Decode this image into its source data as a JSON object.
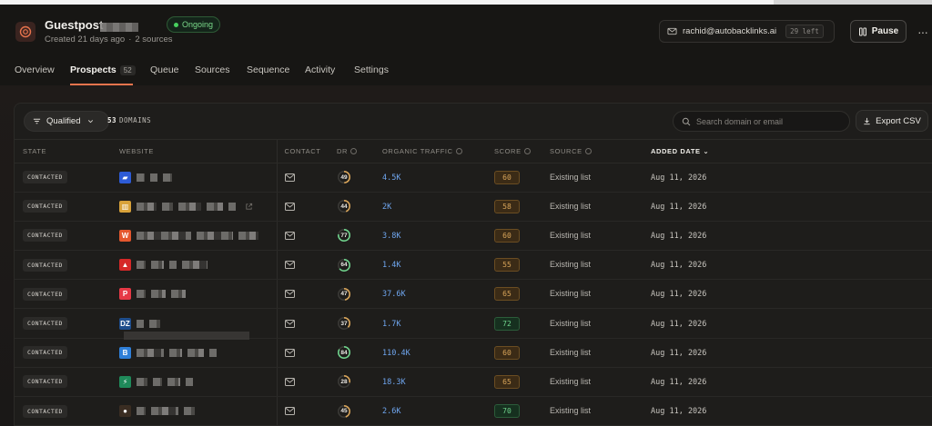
{
  "header": {
    "title": "Guestpost",
    "created": "Created 21 days ago",
    "sources": "2 sources",
    "status": "Ongoing",
    "account_email": "rachid@autobacklinks.ai",
    "account_left": "29 left",
    "pause_label": "Pause",
    "more_label": "···"
  },
  "tabs": [
    {
      "label": "Overview"
    },
    {
      "label": "Prospects",
      "count": "52"
    },
    {
      "label": "Queue"
    },
    {
      "label": "Sources"
    },
    {
      "label": "Sequence"
    },
    {
      "label": "Activity"
    },
    {
      "label": "Settings"
    }
  ],
  "toolbar": {
    "filter_label": "Qualified",
    "domains_count": "53",
    "domains_label": "DOMAINS",
    "search_placeholder": "Search domain or email",
    "export_label": "Export CSV"
  },
  "columns": {
    "state": "STATE",
    "website": "WEBSITE",
    "contact": "CONTACT",
    "dr": "DR",
    "traffic": "ORGANIC TRAFFIC",
    "score": "SCORE",
    "source": "SOURCE",
    "added": "ADDED DATE"
  },
  "colors": {
    "accent": "#e8744d",
    "status_green": "#47d15f",
    "traffic_blue": "#6fa6ef",
    "score_amber": "#d9a55a",
    "score_green": "#6fd38c"
  },
  "rows": [
    {
      "state": "CONTACTED",
      "dr": "49",
      "dr_fraction": 0.49,
      "traffic": "4.5K",
      "score": "60",
      "score_tone": "amber",
      "source": "Existing list",
      "added": "Aug 11, 2026",
      "favicon_color": "#2d5bd6",
      "favicon_glyph": "▰"
    },
    {
      "state": "CONTACTED",
      "dr": "44",
      "dr_fraction": 0.44,
      "traffic": "2K",
      "score": "58",
      "score_tone": "amber",
      "source": "Existing list",
      "added": "Aug 11, 2026",
      "favicon_color": "#d8a23a",
      "favicon_glyph": "▥"
    },
    {
      "state": "CONTACTED",
      "dr": "77",
      "dr_fraction": 0.77,
      "traffic": "3.8K",
      "score": "60",
      "score_tone": "amber",
      "source": "Existing list",
      "added": "Aug 11, 2026",
      "favicon_color": "#e4572e",
      "favicon_glyph": "W"
    },
    {
      "state": "CONTACTED",
      "dr": "64",
      "dr_fraction": 0.64,
      "traffic": "1.4K",
      "score": "55",
      "score_tone": "amber",
      "source": "Existing list",
      "added": "Aug 11, 2026",
      "favicon_color": "#d62828",
      "favicon_glyph": "▲"
    },
    {
      "state": "CONTACTED",
      "dr": "47",
      "dr_fraction": 0.47,
      "traffic": "37.6K",
      "score": "65",
      "score_tone": "amber",
      "source": "Existing list",
      "added": "Aug 11, 2026",
      "favicon_color": "#e63946",
      "favicon_glyph": "P"
    },
    {
      "state": "CONTACTED",
      "dr": "37",
      "dr_fraction": 0.37,
      "traffic": "1.7K",
      "score": "72",
      "score_tone": "green",
      "source": "Existing list",
      "added": "Aug 11, 2026",
      "favicon_color": "#1e4d8c",
      "favicon_glyph": "DZ"
    },
    {
      "state": "CONTACTED",
      "dr": "84",
      "dr_fraction": 0.84,
      "traffic": "110.4K",
      "score": "60",
      "score_tone": "amber",
      "source": "Existing list",
      "added": "Aug 11, 2026",
      "favicon_color": "#2f7fd8",
      "favicon_glyph": "B"
    },
    {
      "state": "CONTACTED",
      "dr": "28",
      "dr_fraction": 0.28,
      "traffic": "18.3K",
      "score": "65",
      "score_tone": "amber",
      "source": "Existing list",
      "added": "Aug 11, 2026",
      "favicon_color": "#1f8a5a",
      "favicon_glyph": "⚡"
    },
    {
      "state": "CONTACTED",
      "dr": "45",
      "dr_fraction": 0.45,
      "traffic": "2.6K",
      "score": "70",
      "score_tone": "green",
      "source": "Existing list",
      "added": "Aug 11, 2026",
      "favicon_color": "#3a2d22",
      "favicon_glyph": "●"
    }
  ]
}
